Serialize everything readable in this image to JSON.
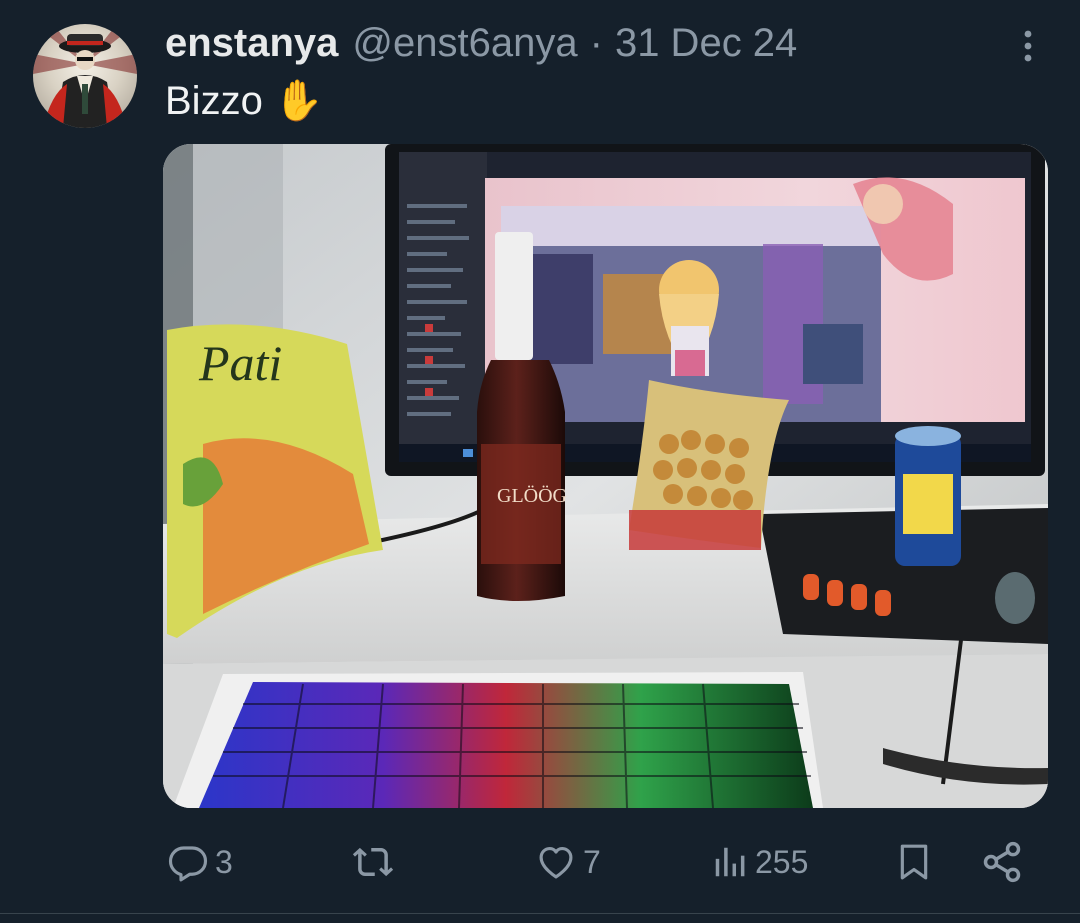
{
  "tweet": {
    "display_name": "enstanya",
    "handle": "@enst6anya",
    "separator": "·",
    "date": "31 Dec 24",
    "text": "Bizzo ✋"
  },
  "actions": {
    "replies": "3",
    "likes": "7",
    "views": "255"
  },
  "icons": {
    "more": "more-vertical-icon",
    "reply": "reply-icon",
    "retweet": "retweet-icon",
    "like": "heart-icon",
    "views": "views-icon",
    "bookmark": "bookmark-icon",
    "share": "share-icon"
  },
  "colors": {
    "background": "#15202b",
    "primary_text": "#e7e9ea",
    "secondary_text": "#8b98a5",
    "divider": "#38444d"
  }
}
